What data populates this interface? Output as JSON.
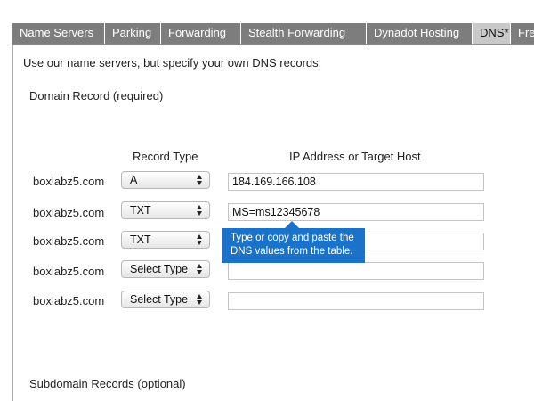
{
  "tabs": [
    {
      "label": "Name Servers",
      "active": false
    },
    {
      "label": "Parking",
      "active": false
    },
    {
      "label": "Forwarding",
      "active": false
    },
    {
      "label": "Stealth Forwarding",
      "active": false
    },
    {
      "label": "Dynadot Hosting",
      "active": false
    },
    {
      "label": "DNS*",
      "active": true
    },
    {
      "label": "Fre",
      "active": false
    }
  ],
  "panel": {
    "intro": "Use our name servers, but specify your own DNS records.",
    "domain_record_title": "Domain Record (required)",
    "subdomain_title": "Subdomain Records (optional)"
  },
  "table": {
    "col_record_type": "Record Type",
    "col_target": "IP Address or Target Host",
    "rows": [
      {
        "domain": "boxlabz5.com",
        "record_type": "A",
        "value": "184.169.166.108"
      },
      {
        "domain": "boxlabz5.com",
        "record_type": "TXT",
        "value": "MS=ms12345678"
      },
      {
        "domain": "boxlabz5.com",
        "record_type": "TXT",
        "value": ""
      },
      {
        "domain": "boxlabz5.com",
        "record_type": "Select Type",
        "value": ""
      },
      {
        "domain": "boxlabz5.com",
        "record_type": "Select Type",
        "value": ""
      }
    ]
  },
  "tooltip": {
    "line1": "Type or copy and paste the",
    "line2": "DNS values from the table."
  },
  "colors": {
    "tab_inactive": "#7d7d7d",
    "tab_active": "#c9c9c9",
    "tooltip_bg": "#1a73c9"
  }
}
